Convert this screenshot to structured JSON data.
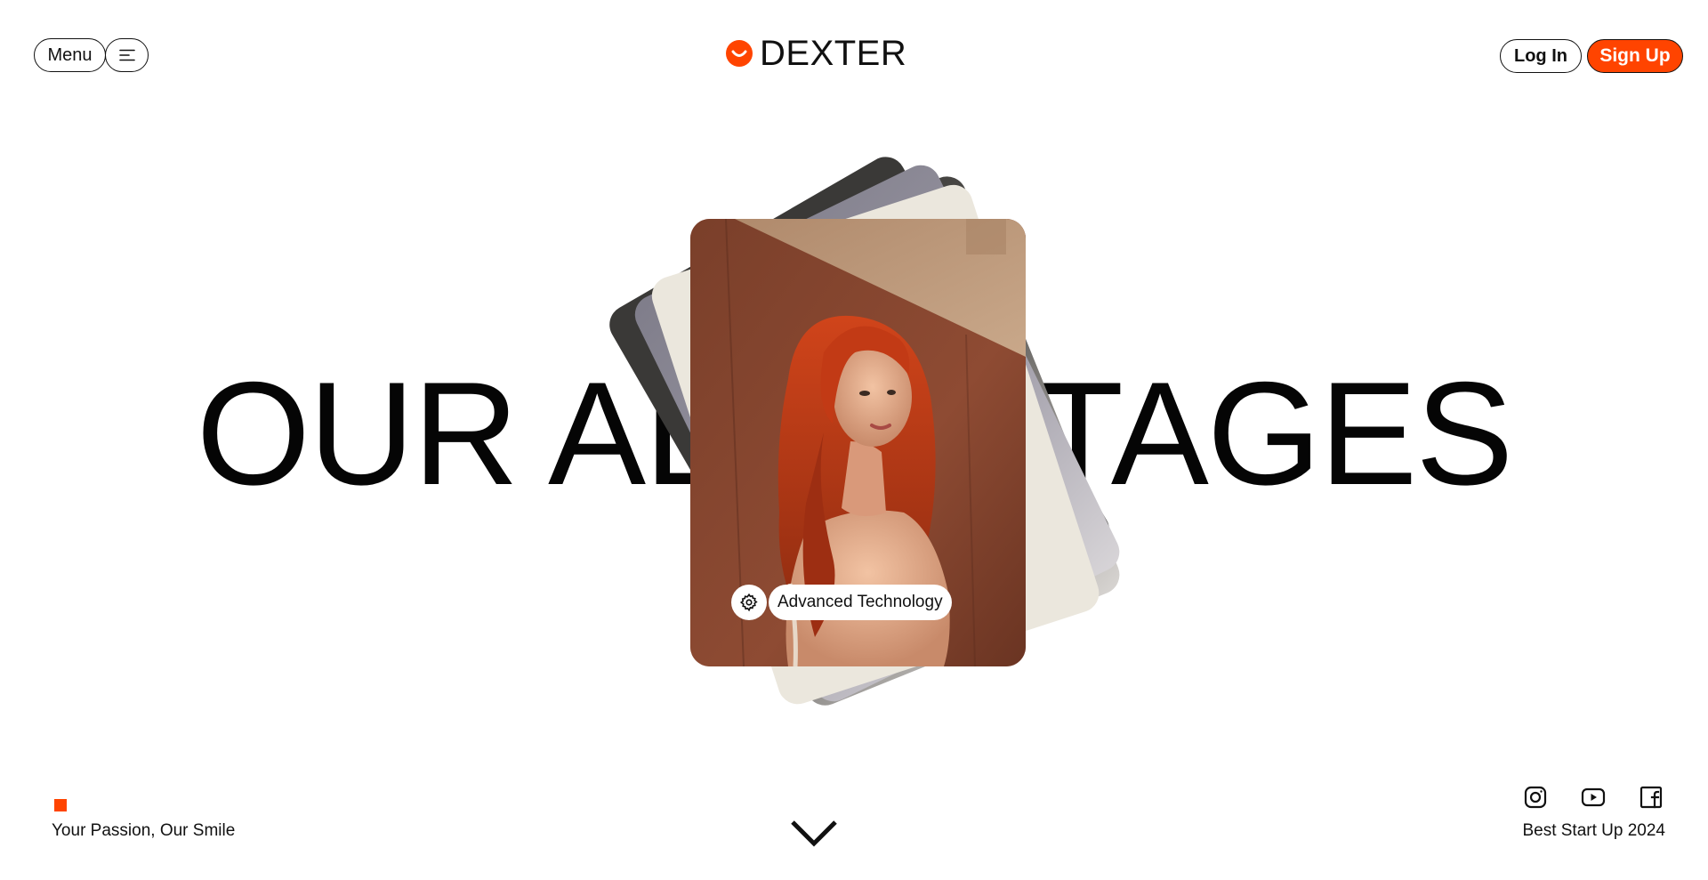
{
  "header": {
    "menu_label": "Menu",
    "menu_icon": "hamburger-icon",
    "logo_text": "DEXTER",
    "logo_icon": "smile-icon",
    "login_label": "Log In",
    "signup_label": "Sign Up"
  },
  "hero": {
    "headline": "OUR ADVANTAGES",
    "card_tag": {
      "icon": "gear-icon",
      "label": "Advanced Technology"
    }
  },
  "footer": {
    "tagline": "Your Passion, Our Smile",
    "scroll_icon": "chevron-down-icon",
    "social_icons": [
      "instagram-icon",
      "youtube-icon",
      "facebook-icon"
    ],
    "award": "Best Start Up 2024"
  },
  "colors": {
    "accent": "#ff4400",
    "text": "#111111",
    "background": "#ffffff"
  }
}
